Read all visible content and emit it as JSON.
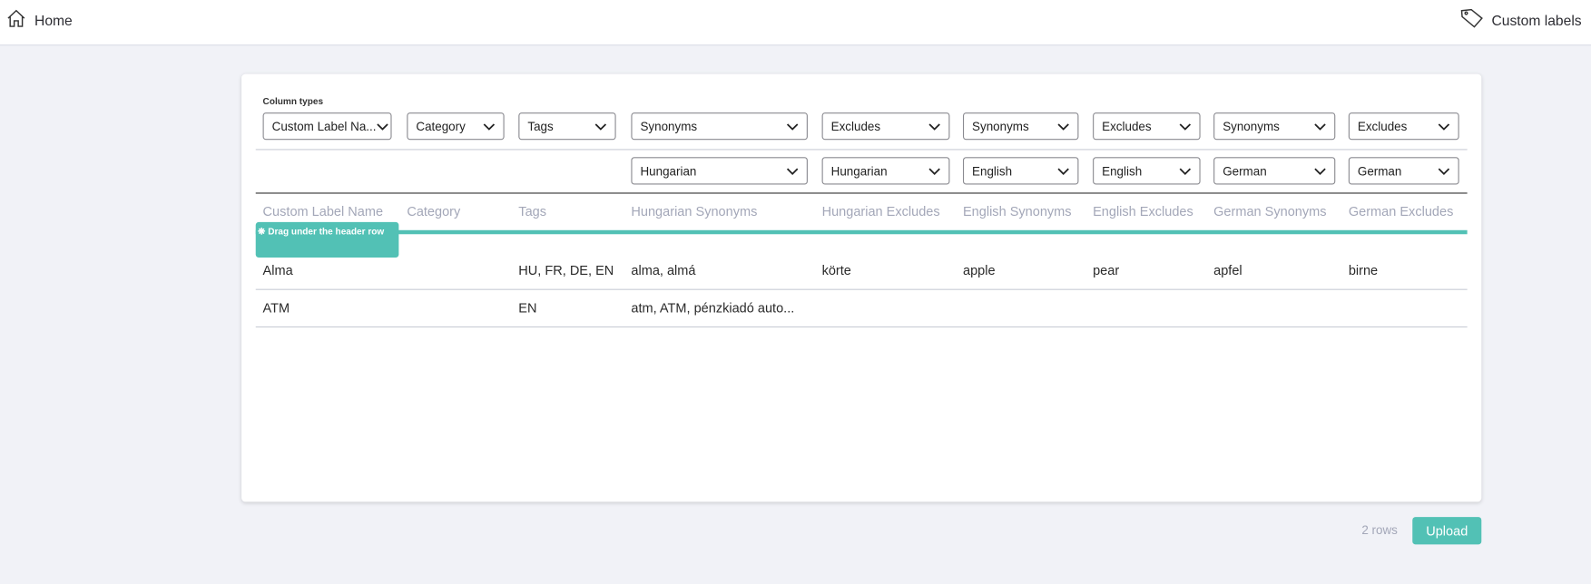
{
  "topbar": {
    "home_label": "Home",
    "custom_labels_label": "Custom labels"
  },
  "column_types_label": "Column types",
  "type_selects": [
    "Custom Label Na...",
    "Category",
    "Tags",
    "Synonyms",
    "Excludes",
    "Synonyms",
    "Excludes",
    "Synonyms",
    "Excludes"
  ],
  "language_selects": [
    "",
    "",
    "",
    "Hungarian",
    "Hungarian",
    "English",
    "English",
    "German",
    "German"
  ],
  "headers": [
    "Custom Label Name",
    "Category",
    "Tags",
    "Hungarian Synonyms",
    "Hungarian Excludes",
    "English Synonyms",
    "English Excludes",
    "German Synonyms",
    "German Excludes"
  ],
  "drag_hint": "Drag under the header row",
  "rows": [
    [
      "Alma",
      "",
      "HU, FR, DE, EN",
      "alma, almá",
      "körte",
      "apple",
      "pear",
      "apfel",
      "birne"
    ],
    [
      "ATM",
      "",
      "EN",
      "atm, ATM, pénzkiadó auto...",
      "",
      "",
      "",
      "",
      ""
    ]
  ],
  "footer": {
    "row_count": "2 rows",
    "upload_label": "Upload"
  },
  "colors": {
    "accent": "#52c1b5",
    "background": "#f1f2f7",
    "header_text": "#a3a7b8"
  }
}
